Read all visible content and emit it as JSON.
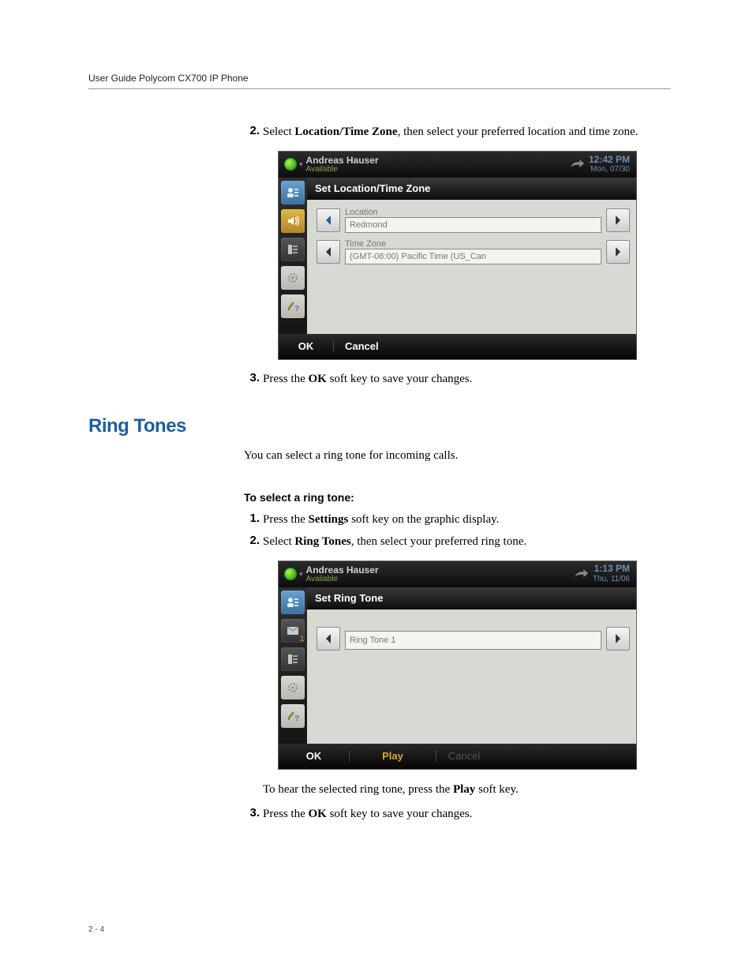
{
  "runningHead": "User Guide Polycom CX700 IP Phone",
  "pageNum": "2 - 4",
  "sec1": {
    "step2": {
      "num": "2.",
      "before": "Select ",
      "bold": "Location/Time Zone",
      "after": ", then select your preferred location and time zone."
    },
    "step3": {
      "num": "3.",
      "before": "Press the ",
      "bold": "OK",
      "after": " soft key to save your changes."
    }
  },
  "phone1": {
    "user": "Andreas Hauser",
    "presence": "Available",
    "time": "12:42 PM",
    "date": "Mon, 07/30",
    "screenTitle": "Set Location/Time Zone",
    "location": {
      "label": "Location",
      "value": "Redmond"
    },
    "timezone": {
      "label": "Time Zone",
      "value": "(GMT-08:00) Pacific Time (US_Can"
    },
    "sk": {
      "ok": "OK",
      "cancel": "Cancel"
    }
  },
  "ringTones": {
    "heading": "Ring Tones",
    "intro": "You can select a ring tone for incoming calls.",
    "subhead": "To select a ring tone:",
    "step1": {
      "num": "1.",
      "before": "Press the ",
      "bold": "Settings",
      "after": " soft key on the graphic display."
    },
    "step2": {
      "num": "2.",
      "before": "Select ",
      "bold": "Ring Tones",
      "after": ", then select your preferred ring tone."
    },
    "afterPhone": {
      "before": "To hear the selected ring tone, press the ",
      "bold": "Play",
      "after": " soft key."
    },
    "step3": {
      "num": "3.",
      "before": "Press the ",
      "bold": "OK",
      "after": " soft key to save your changes."
    }
  },
  "phone2": {
    "user": "Andreas Hauser",
    "presence": "Available",
    "time": "1:13 PM",
    "date": "Thu, 11/06",
    "screenTitle": "Set Ring Tone",
    "ringtone": {
      "value": "Ring Tone 1"
    },
    "sk": {
      "ok": "OK",
      "play": "Play",
      "cancel": "Cancel"
    }
  }
}
